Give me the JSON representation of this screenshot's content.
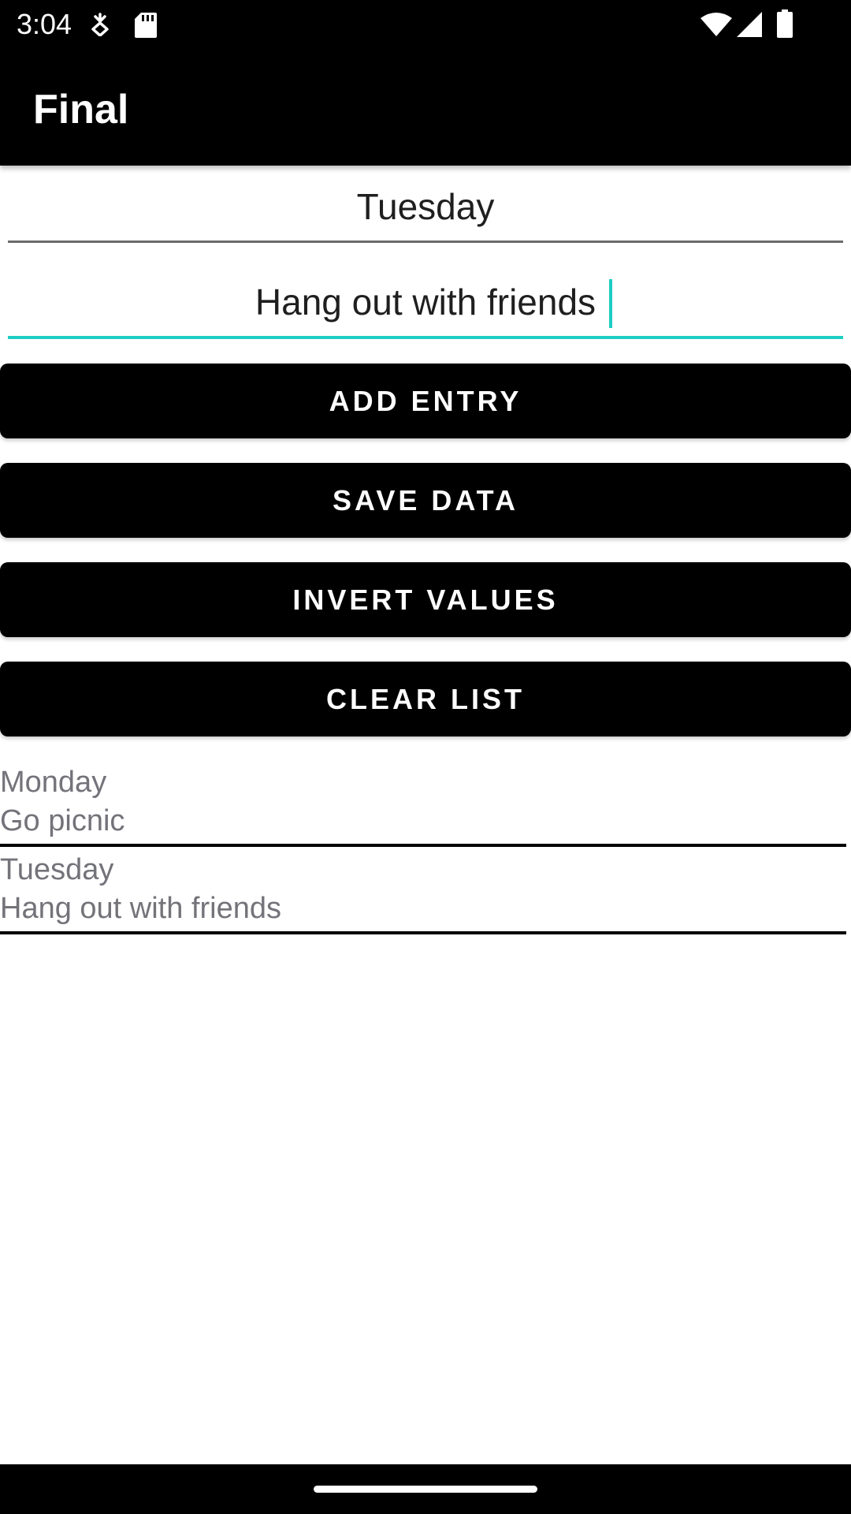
{
  "status_bar": {
    "time": "3:04",
    "icons": [
      "download-status-icon",
      "sd-card-icon",
      "wifi-icon",
      "signal-icon",
      "battery-icon"
    ]
  },
  "app_bar": {
    "title": "Final"
  },
  "form": {
    "day_value": "Tuesday",
    "activity_value": "Hang out with friends",
    "accent_color": "#1ecdc4"
  },
  "buttons": {
    "add_entry": "ADD ENTRY",
    "save_data": "SAVE DATA",
    "invert_values": "INVERT VALUES",
    "clear_list": "CLEAR LIST"
  },
  "entries": [
    {
      "day": "Monday",
      "activity": "Go picnic"
    },
    {
      "day": "Tuesday",
      "activity": "Hang out with friends"
    }
  ],
  "colors": {
    "bar_background": "#000000",
    "entry_text": "#73737a",
    "field_text": "#1f1f1f"
  }
}
